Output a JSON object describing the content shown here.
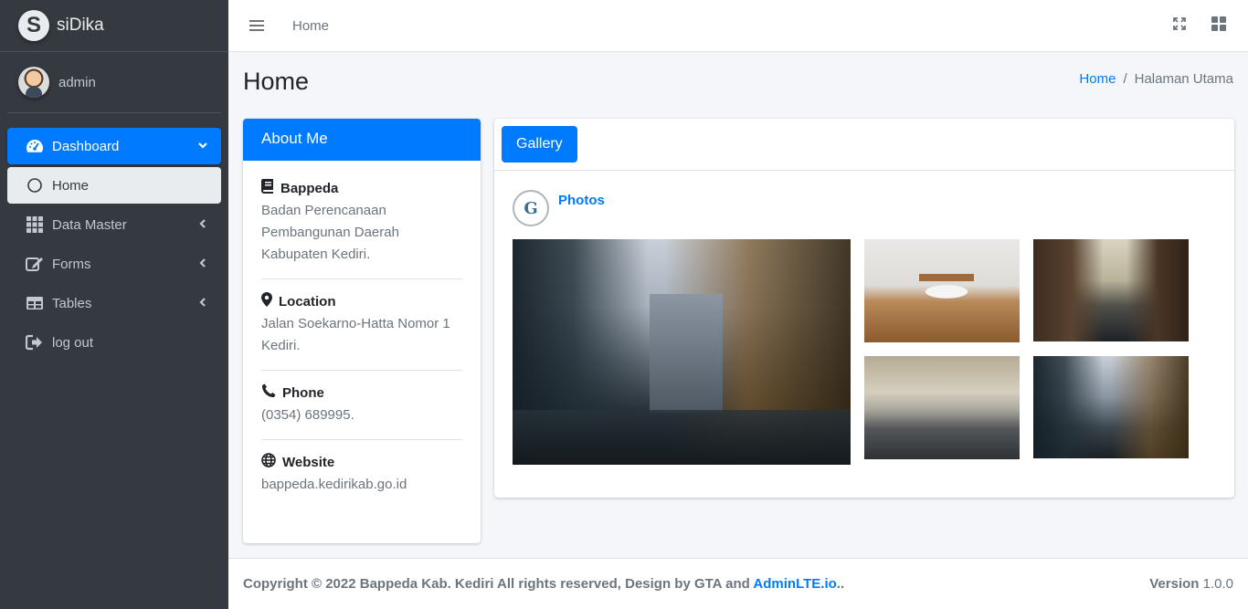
{
  "brand": {
    "logo_letter": "S",
    "name": "siDika"
  },
  "user": {
    "name": "admin"
  },
  "sidebar": {
    "items": [
      {
        "label": "Dashboard",
        "icon": "tachometer-icon",
        "state": "active"
      },
      {
        "label": "Home",
        "icon": "circle-icon",
        "state": "sub-active"
      },
      {
        "label": "Data Master",
        "icon": "grid-icon"
      },
      {
        "label": "Forms",
        "icon": "edit-icon"
      },
      {
        "label": "Tables",
        "icon": "table-icon"
      },
      {
        "label": "log out",
        "icon": "sign-out-icon"
      }
    ]
  },
  "topbar": {
    "home_link": "Home"
  },
  "page": {
    "title": "Home"
  },
  "breadcrumb": {
    "home": "Home",
    "separator": "/",
    "current": "Halaman Utama"
  },
  "about": {
    "header": "About Me",
    "blocks": [
      {
        "title": "Bappeda",
        "text": "Badan Perencanaan Pembangunan Daerah Kabupaten Kediri."
      },
      {
        "title": "Location",
        "text": "Jalan Soekarno-Hatta Nomor 1 Kediri."
      },
      {
        "title": "Phone",
        "text": "(0354) 689995."
      },
      {
        "title": "Website",
        "text": "bappeda.kedirikab.go.id"
      }
    ]
  },
  "gallery": {
    "tab_label": "Gallery",
    "avatar_letter": "G",
    "post_title": "Photos"
  },
  "footer": {
    "copyright": "Copyright © 2022 Bappeda Kab. Kediri All rights reserved, Design by GTA and ",
    "link": "AdminLTE.io",
    "trailing": "..",
    "version_label": "Version",
    "version_value": "1.0.0"
  },
  "colors": {
    "primary": "#007bff",
    "sidebar_bg": "#343a40",
    "content_bg": "#f4f6f9"
  }
}
